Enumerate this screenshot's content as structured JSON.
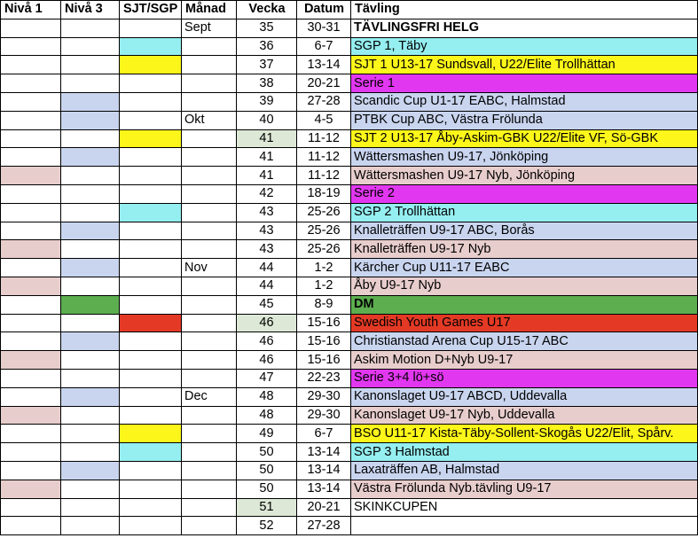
{
  "colors": {
    "cyan": "#95eef0",
    "yellow": "#fcf61a",
    "magenta": "#e237f0",
    "blue": "#c9d5ef",
    "pink": "#e8cdcd",
    "green": "#5cae4f",
    "red": "#e43a25",
    "lightgreen": "#dde9d6",
    "white": "#ffffff"
  },
  "headers": [
    "Nivå 1",
    "Nivå 3",
    "SJT/SGP",
    "Månad",
    "Vecka",
    "Datum",
    "Tävling"
  ],
  "rows": [
    {
      "n1": "",
      "n3": "",
      "sjt": "",
      "month": "Sept",
      "week": "35",
      "date": "30-31",
      "event": "TÄVLINGSFRI HELG",
      "ev": "white",
      "bold": true
    },
    {
      "n1": "",
      "n3": "",
      "sjt": "cyan",
      "month": "",
      "week": "36",
      "date": "6-7",
      "event": "SGP 1, Täby",
      "ev": "cyan"
    },
    {
      "n1": "",
      "n3": "",
      "sjt": "yellow",
      "month": "",
      "week": "37",
      "date": "13-14",
      "event": "SJT 1  U13-17 Sundsvall, U22/Elite Trollhättan",
      "ev": "yellow"
    },
    {
      "n1": "",
      "n3": "",
      "sjt": "",
      "month": "",
      "week": "38",
      "date": "20-21",
      "event": "Serie 1",
      "ev": "magenta"
    },
    {
      "n1": "",
      "n3": "blue",
      "sjt": "",
      "month": "",
      "week": "39",
      "date": "27-28",
      "event": "Scandic Cup U1-17 EABC, Halmstad",
      "ev": "blue"
    },
    {
      "n1": "",
      "n3": "blue",
      "sjt": "",
      "month": "Okt",
      "week": "40",
      "date": "4-5",
      "event": "PTBK Cup  ABC, Västra Frölunda",
      "ev": "blue"
    },
    {
      "n1": "",
      "n3": "",
      "sjt": "yellow",
      "month": "",
      "week": "41",
      "wk": "lightgreen",
      "date": "11-12",
      "event": "SJT 2  U13-17 Åby-Askim-GBK U22/Elite VF, Sö-GBK",
      "ev": "yellow"
    },
    {
      "n1": "",
      "n3": "blue",
      "sjt": "",
      "month": "",
      "week": "41",
      "date": "11-12",
      "event": "Wättersmashen U9-17, Jönköping",
      "ev": "blue"
    },
    {
      "n1": "pink",
      "n3": "",
      "sjt": "",
      "month": "",
      "week": "41",
      "date": "11-12",
      "event": "Wättersmashen U9-17 Nyb, Jönköping",
      "ev": "pink"
    },
    {
      "n1": "",
      "n3": "",
      "sjt": "",
      "month": "",
      "week": "42",
      "date": "18-19",
      "event": "Serie 2",
      "ev": "magenta"
    },
    {
      "n1": "",
      "n3": "",
      "sjt": "cyan",
      "month": "",
      "week": "43",
      "date": "25-26",
      "event": "SGP 2 Trollhättan",
      "ev": "cyan"
    },
    {
      "n1": "",
      "n3": "blue",
      "sjt": "",
      "month": "",
      "week": "43",
      "date": "25-26",
      "event": "Knalleträffen U9-17 ABC, Borås",
      "ev": "blue"
    },
    {
      "n1": "pink",
      "n3": "",
      "sjt": "",
      "month": "",
      "week": "43",
      "date": "25-26",
      "event": "Knalleträffen U9-17 Nyb",
      "ev": "pink"
    },
    {
      "n1": "",
      "n3": "blue",
      "sjt": "",
      "month": "Nov",
      "week": "44",
      "date": "1-2",
      "event": "Kärcher Cup U11-17 EABC",
      "ev": "blue"
    },
    {
      "n1": "pink",
      "n3": "",
      "sjt": "",
      "month": "",
      "week": "44",
      "date": "1-2",
      "event": "Åby U9-17 Nyb",
      "ev": "pink"
    },
    {
      "n1": "",
      "n3": "green",
      "sjt": "",
      "month": "",
      "week": "45",
      "date": "8-9",
      "event": "DM",
      "ev": "green",
      "bold": true
    },
    {
      "n1": "",
      "n3": "",
      "sjt": "red",
      "month": "",
      "week": "46",
      "wk": "lightgreen",
      "date": "15-16",
      "event": "Swedish Youth Games U17",
      "ev": "red"
    },
    {
      "n1": "",
      "n3": "blue",
      "sjt": "",
      "month": "",
      "week": "46",
      "date": "15-16",
      "event": "Christianstad Arena Cup U15-17 ABC",
      "ev": "blue"
    },
    {
      "n1": "pink",
      "n3": "",
      "sjt": "",
      "month": "",
      "week": "46",
      "date": "15-16",
      "event": "Askim Motion D+Nyb U9-17",
      "ev": "pink"
    },
    {
      "n1": "",
      "n3": "",
      "sjt": "",
      "month": "",
      "week": "47",
      "date": "22-23",
      "event": "Serie 3+4  lö+sö",
      "ev": "magenta"
    },
    {
      "n1": "",
      "n3": "blue",
      "sjt": "",
      "month": "Dec",
      "week": "48",
      "date": "29-30",
      "event": "Kanonslaget U9-17 ABCD, Uddevalla",
      "ev": "blue"
    },
    {
      "n1": "pink",
      "n3": "",
      "sjt": "",
      "month": "",
      "week": "48",
      "date": "29-30",
      "event": "Kanonslaget U9-17 Nyb, Uddevalla",
      "ev": "pink"
    },
    {
      "n1": "",
      "n3": "",
      "sjt": "yellow",
      "month": "",
      "week": "49",
      "date": "6-7",
      "event": "BSO U11-17 Kista-Täby-Sollent-Skogås U22/Elit, Spårv.",
      "ev": "yellow"
    },
    {
      "n1": "",
      "n3": "",
      "sjt": "cyan",
      "month": "",
      "week": "50",
      "date": "13-14",
      "event": "SGP 3 Halmstad",
      "ev": "cyan"
    },
    {
      "n1": "",
      "n3": "blue",
      "sjt": "",
      "month": "",
      "week": "50",
      "date": "13-14",
      "event": "Laxaträffen AB, Halmstad",
      "ev": "blue"
    },
    {
      "n1": "pink",
      "n3": "",
      "sjt": "",
      "month": "",
      "week": "50",
      "date": "13-14",
      "event": "Västra Frölunda Nyb.tävling U9-17",
      "ev": "pink"
    },
    {
      "n1": "",
      "n3": "",
      "sjt": "",
      "month": "",
      "week": "51",
      "wk": "lightgreen",
      "date": "20-21",
      "event": "SKINKCUPEN",
      "ev": "white"
    },
    {
      "n1": "",
      "n3": "",
      "sjt": "",
      "month": "",
      "week": "52",
      "date": "27-28",
      "event": "",
      "ev": "white"
    }
  ]
}
